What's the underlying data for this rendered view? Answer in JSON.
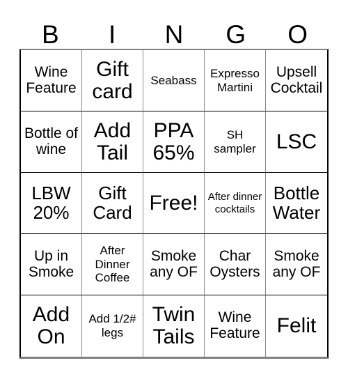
{
  "card": {
    "title": "BINGO",
    "header_letters": [
      "B",
      "I",
      "N",
      "G",
      "O"
    ],
    "grid_size": "5x5",
    "free_space_label": "Free!",
    "rows": [
      [
        {
          "text": "Wine Feature",
          "size": "md"
        },
        {
          "text": "Gift card",
          "size": "xl"
        },
        {
          "text": "Seabass",
          "size": "sm"
        },
        {
          "text": "Expresso Martini",
          "size": "sm"
        },
        {
          "text": "Upsell Cocktail",
          "size": "md"
        }
      ],
      [
        {
          "text": "Bottle of wine",
          "size": "md"
        },
        {
          "text": "Add Tail",
          "size": "xl"
        },
        {
          "text": "PPA 65%",
          "size": "xl"
        },
        {
          "text": "SH sampler",
          "size": "sm"
        },
        {
          "text": "LSC",
          "size": "xl"
        }
      ],
      [
        {
          "text": "LBW 20%",
          "size": "lg"
        },
        {
          "text": "Gift Card",
          "size": "lg"
        },
        {
          "text": "Free!",
          "size": "xl"
        },
        {
          "text": "After dinner cocktails",
          "size": "xs"
        },
        {
          "text": "Bottle Water",
          "size": "lg"
        }
      ],
      [
        {
          "text": "Up in Smoke",
          "size": "md"
        },
        {
          "text": "After Dinner Coffee",
          "size": "sm"
        },
        {
          "text": "Smoke any OF",
          "size": "md"
        },
        {
          "text": "Char Oysters",
          "size": "md"
        },
        {
          "text": "Smoke any OF",
          "size": "md"
        }
      ],
      [
        {
          "text": "Add On",
          "size": "xl"
        },
        {
          "text": "Add 1/2# legs",
          "size": "sm"
        },
        {
          "text": "Twin Tails",
          "size": "xl"
        },
        {
          "text": "Wine Feature",
          "size": "md"
        },
        {
          "text": "Felit",
          "size": "xl"
        }
      ]
    ],
    "colors": {
      "background": "#ffffff",
      "text": "#000000",
      "grid_line": "#000000",
      "grid_line_light": "#8a8a8a"
    }
  }
}
